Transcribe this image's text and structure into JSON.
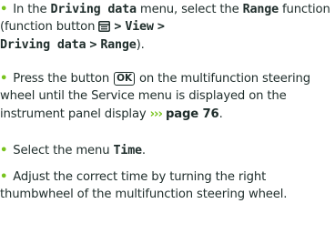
{
  "colors": {
    "bullet": "#78c31e",
    "text": "#1f2d2b"
  },
  "step1": {
    "bullet": "•",
    "t1": "In the",
    "menu": "Driving data",
    "t2": "menu, select the",
    "function": "Range",
    "t3": "function (function button",
    "icon": "function-button-icon",
    "path_sep1": ">",
    "path_view": "View",
    "path_sep2": ">",
    "path_data": "Driving data",
    "path_sep3": ">",
    "path_range": "Range",
    "t4": ")."
  },
  "step2": {
    "bullet": "•",
    "t1": "Press the button",
    "ok_key": "OK",
    "t2": "on the multifunction steering wheel until the Service menu is displayed on the instrument panel display",
    "ref_arrows": "›››",
    "ref_page": "page 76",
    "t3": "."
  },
  "step3": {
    "bullet": "•",
    "t1": "Select the menu",
    "menu": "Time",
    "t2": "."
  },
  "step4": {
    "bullet": "•",
    "text": "Adjust the correct time by turning the right thumbwheel of the multifunction steering wheel."
  }
}
